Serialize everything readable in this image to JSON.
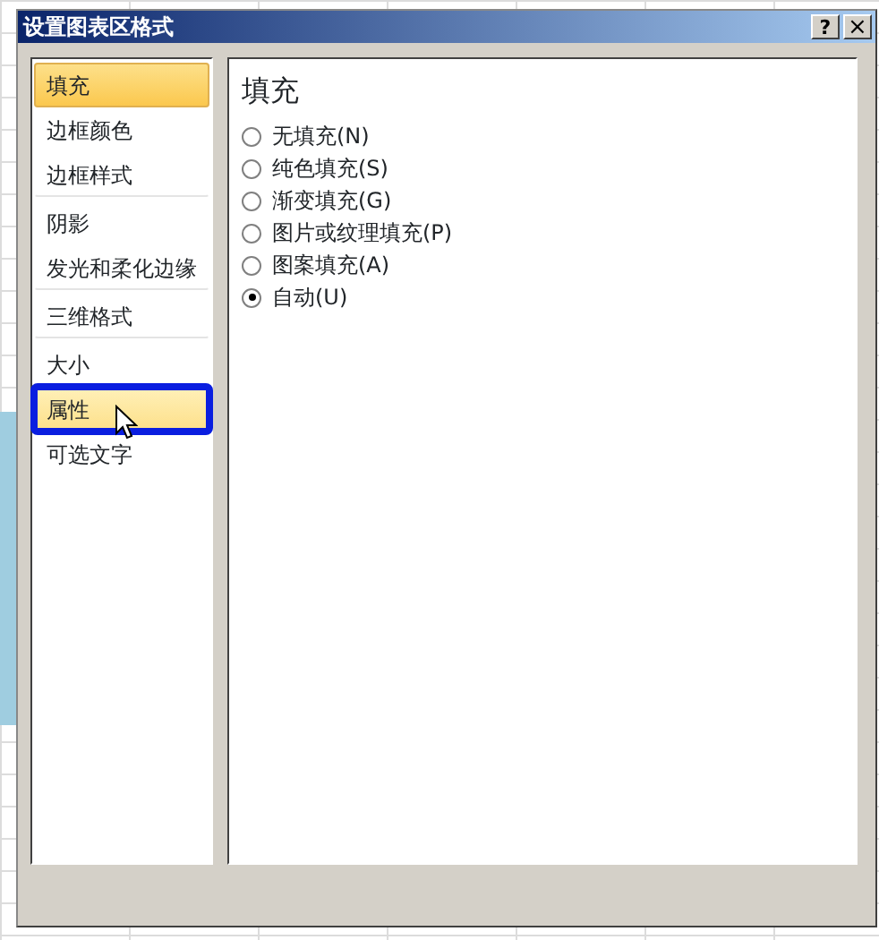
{
  "window": {
    "title": "设置图表区格式",
    "buttons": [
      {
        "kind": "help",
        "label": "?"
      },
      {
        "kind": "close",
        "label": "×"
      }
    ]
  },
  "sidebar": {
    "items": [
      {
        "label": "填充",
        "selected": true,
        "hovered": false,
        "group_end": false,
        "annotated": false
      },
      {
        "label": "边框颜色",
        "selected": false,
        "hovered": false,
        "group_end": false,
        "annotated": false
      },
      {
        "label": "边框样式",
        "selected": false,
        "hovered": false,
        "group_end": true,
        "annotated": false
      },
      {
        "label": "阴影",
        "selected": false,
        "hovered": false,
        "group_end": false,
        "annotated": false
      },
      {
        "label": "发光和柔化边缘",
        "selected": false,
        "hovered": false,
        "group_end": true,
        "annotated": false
      },
      {
        "label": "三维格式",
        "selected": false,
        "hovered": false,
        "group_end": true,
        "annotated": false
      },
      {
        "label": "大小",
        "selected": false,
        "hovered": false,
        "group_end": false,
        "annotated": false
      },
      {
        "label": "属性",
        "selected": false,
        "hovered": true,
        "group_end": false,
        "annotated": true
      },
      {
        "label": "可选文字",
        "selected": false,
        "hovered": false,
        "group_end": false,
        "annotated": false
      }
    ]
  },
  "panel": {
    "heading": "填充",
    "options": [
      {
        "label": "无填充(N)",
        "selected": false
      },
      {
        "label": "纯色填充(S)",
        "selected": false
      },
      {
        "label": "渐变填充(G)",
        "selected": false
      },
      {
        "label": "图片或纹理填充(P)",
        "selected": false
      },
      {
        "label": "图案填充(A)",
        "selected": false
      },
      {
        "label": "自动(U)",
        "selected": true
      }
    ]
  }
}
